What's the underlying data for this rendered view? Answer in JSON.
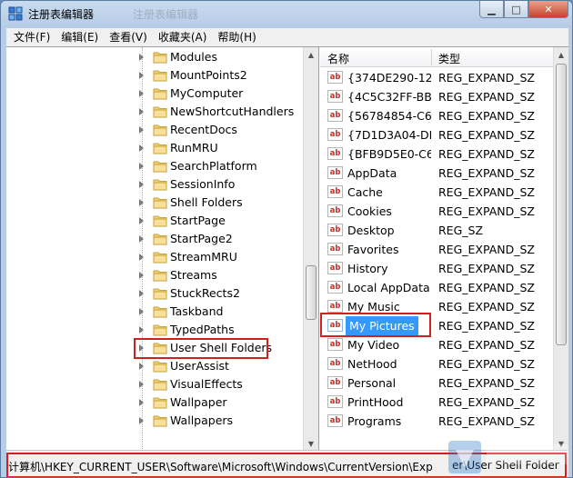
{
  "window": {
    "title": "注册表编辑器",
    "title_ghost": "注册表编辑器"
  },
  "menu": [
    "文件(F)",
    "编辑(E)",
    "查看(V)",
    "收藏夹(A)",
    "帮助(H)"
  ],
  "tree": {
    "items": [
      "Modules",
      "MountPoints2",
      "MyComputer",
      "NewShortcutHandlers",
      "RecentDocs",
      "RunMRU",
      "SearchPlatform",
      "SessionInfo",
      "Shell Folders",
      "StartPage",
      "StartPage2",
      "StreamMRU",
      "Streams",
      "StuckRects2",
      "Taskband",
      "TypedPaths",
      "User Shell Folders",
      "UserAssist",
      "VisualEffects",
      "Wallpaper",
      "Wallpapers"
    ],
    "highlighted": "User Shell Folders"
  },
  "list": {
    "headers": {
      "name": "名称",
      "type": "类型"
    },
    "rows": [
      {
        "name": "{374DE290-12...",
        "type": "REG_EXPAND_SZ"
      },
      {
        "name": "{4C5C32FF-BB...",
        "type": "REG_EXPAND_SZ"
      },
      {
        "name": "{56784854-C6...",
        "type": "REG_EXPAND_SZ"
      },
      {
        "name": "{7D1D3A04-DE...",
        "type": "REG_EXPAND_SZ"
      },
      {
        "name": "{BFB9D5E0-C6...",
        "type": "REG_EXPAND_SZ"
      },
      {
        "name": "AppData",
        "type": "REG_EXPAND_SZ"
      },
      {
        "name": "Cache",
        "type": "REG_EXPAND_SZ"
      },
      {
        "name": "Cookies",
        "type": "REG_EXPAND_SZ"
      },
      {
        "name": "Desktop",
        "type": "REG_SZ"
      },
      {
        "name": "Favorites",
        "type": "REG_EXPAND_SZ"
      },
      {
        "name": "History",
        "type": "REG_EXPAND_SZ"
      },
      {
        "name": "Local AppData",
        "type": "REG_EXPAND_SZ"
      },
      {
        "name": "My Music",
        "type": "REG_EXPAND_SZ"
      },
      {
        "name": "My Pictures",
        "type": "REG_EXPAND_SZ"
      },
      {
        "name": "My Video",
        "type": "REG_EXPAND_SZ"
      },
      {
        "name": "NetHood",
        "type": "REG_EXPAND_SZ"
      },
      {
        "name": "Personal",
        "type": "REG_EXPAND_SZ"
      },
      {
        "name": "PrintHood",
        "type": "REG_EXPAND_SZ"
      },
      {
        "name": "Programs",
        "type": "REG_EXPAND_SZ"
      }
    ],
    "selected": "My Pictures",
    "value_icon": "ab"
  },
  "status": {
    "path": "计算机\\HKEY_CURRENT_USER\\Software\\Microsoft\\Windows\\CurrentVersion\\Exp",
    "tail": "er\\User Shell Folder"
  },
  "colors": {
    "highlight_box": "#d21f1f",
    "selection": "#3399ff"
  }
}
